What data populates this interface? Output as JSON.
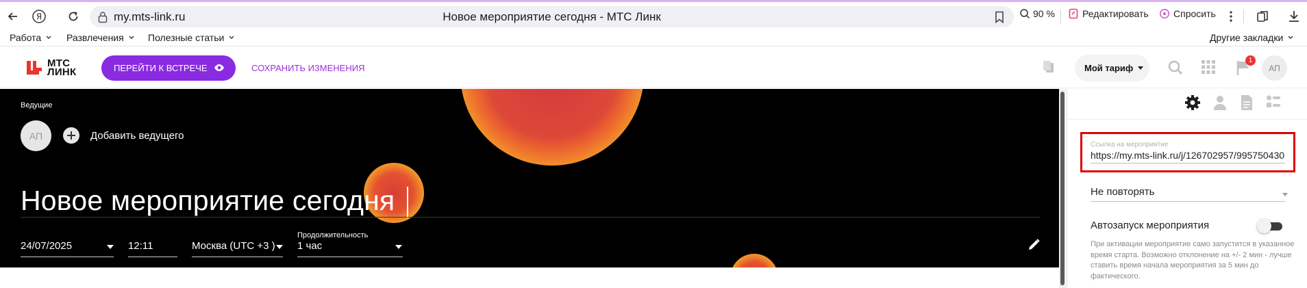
{
  "browser": {
    "url": "my.mts-link.ru",
    "tab_title": "Новое мероприятие сегодня - МТС Линк",
    "zoom": "90 %",
    "edit_label": "Редактировать",
    "ask_label": "Спросить"
  },
  "bookmarks": {
    "items": [
      "Работа",
      "Развлечения",
      "Полезные статьи"
    ],
    "other": "Другие закладки"
  },
  "header": {
    "logo_line1": "МТС",
    "logo_line2": "ЛИНК",
    "go_button": "ПЕРЕЙТИ К ВСТРЕЧЕ",
    "save_link": "СОХРАНИТЬ ИЗМЕНЕНИЯ",
    "tariff": "Мой тариф",
    "notification_count": "1",
    "avatar": "АП"
  },
  "event": {
    "hosts_label": "Ведущие",
    "host_avatar": "АП",
    "add_host": "Добавить ведущего",
    "title": "Новое мероприятие сегодня",
    "date": "24/07/2025",
    "time": "12:11",
    "timezone": "Москва (UTC +3 )",
    "duration_label": "Продолжительность",
    "duration": "1 час"
  },
  "side_panel": {
    "link_label": "Ссылка на мероприятие",
    "link_value": "https://my.mts-link.ru/j/126702957/995750430",
    "repeat": "Не повторять",
    "autostart_label": "Автозапуск мероприятия",
    "autostart_note": "При активации мероприятие само запустится в указанное время старта. Возможно отклонение на +/- 2 мин - лучше ставить время начала мероприятия за 5 мин до фактического."
  },
  "colors": {
    "accent": "#8a2be2",
    "brand_red": "#e8352e",
    "highlight": "#e00000"
  }
}
